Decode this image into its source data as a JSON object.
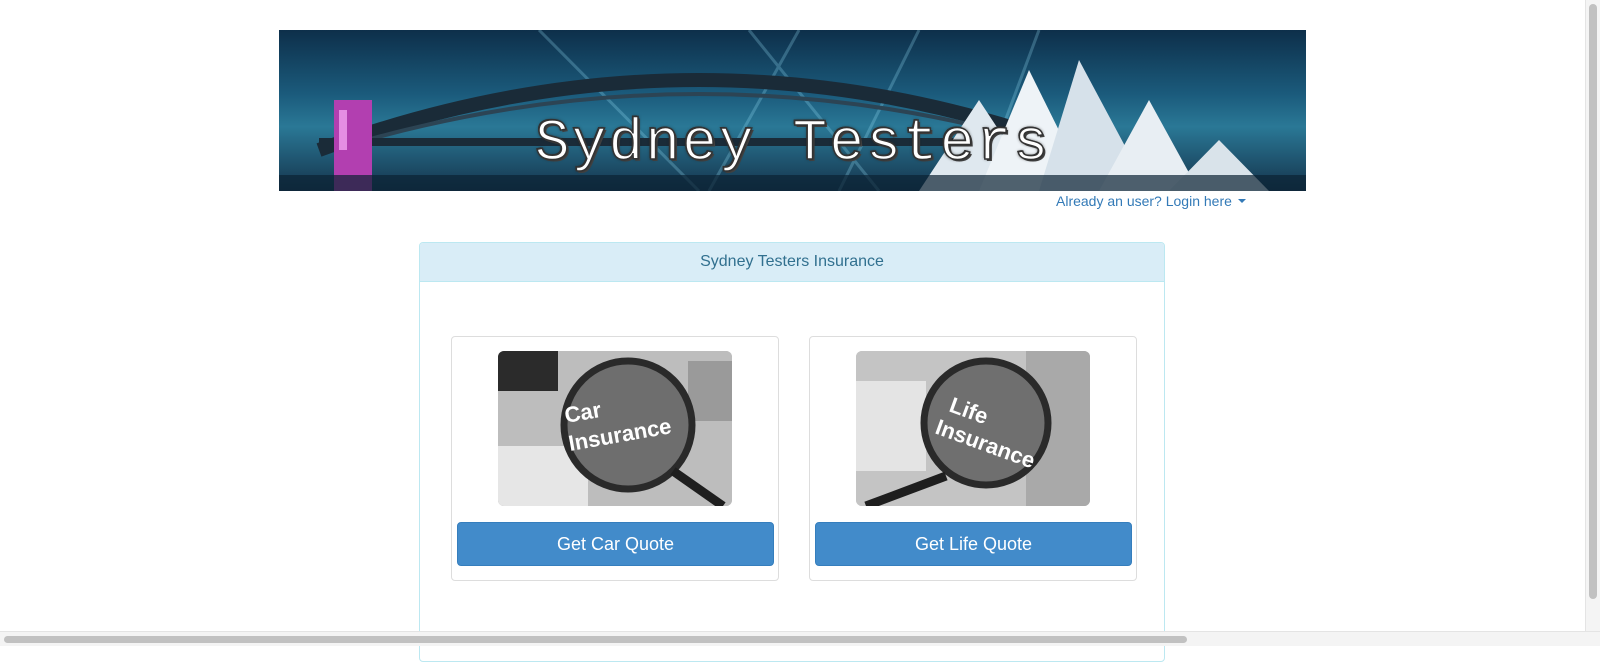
{
  "header": {
    "banner_title": "Sydney Testers",
    "login_link": "Already an user? Login here"
  },
  "panel": {
    "heading": "Sydney Testers Insurance",
    "cards": [
      {
        "image_text_1": "Car",
        "image_text_2": "Insurance",
        "button_label": "Get Car Quote"
      },
      {
        "image_text_1": "Life",
        "image_text_2": "Insurance",
        "button_label": "Get Life Quote"
      }
    ]
  },
  "colors": {
    "link": "#337ab7",
    "primary_button": "#428bca",
    "panel_heading_bg": "#d9edf7",
    "panel_heading_text": "#31708f"
  },
  "icons": [
    "caret-down-icon"
  ]
}
